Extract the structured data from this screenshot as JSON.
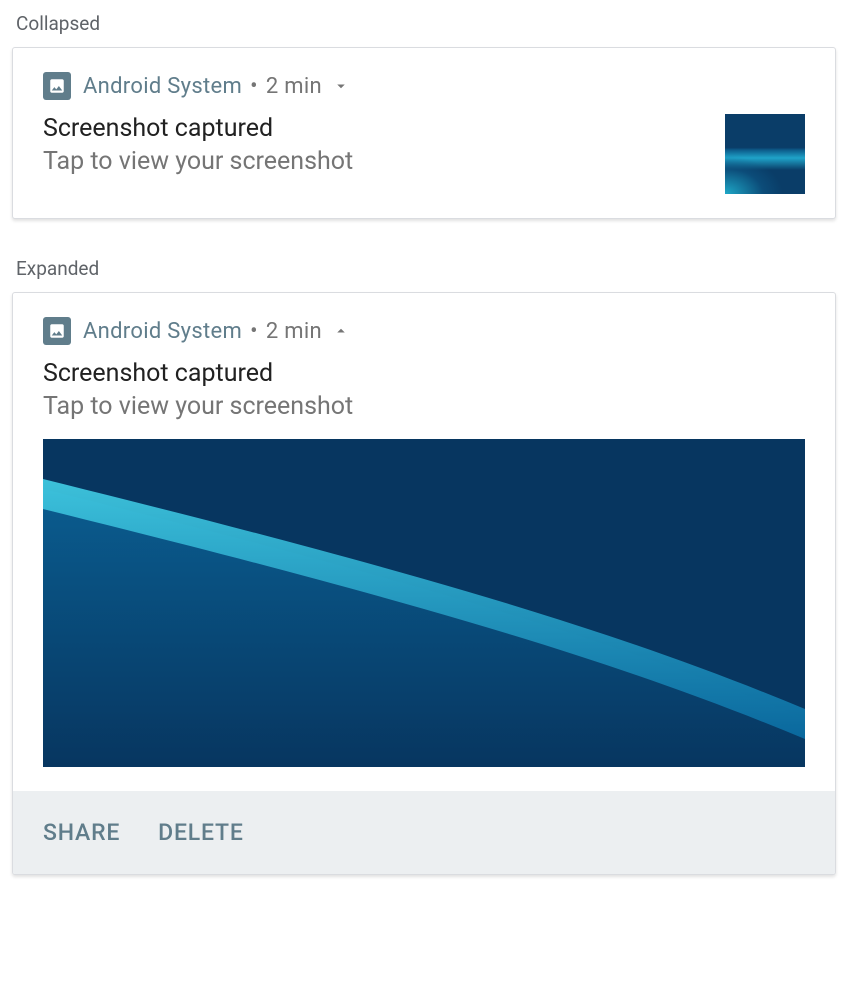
{
  "sections": {
    "collapsed_label": "Collapsed",
    "expanded_label": "Expanded"
  },
  "notification": {
    "app_name": "Android  System",
    "separator": "•",
    "timestamp": "2 min",
    "title": "Screenshot captured",
    "subtitle": "Tap to view your screenshot"
  },
  "actions": {
    "share": "SHARE",
    "delete": "DELETE"
  }
}
